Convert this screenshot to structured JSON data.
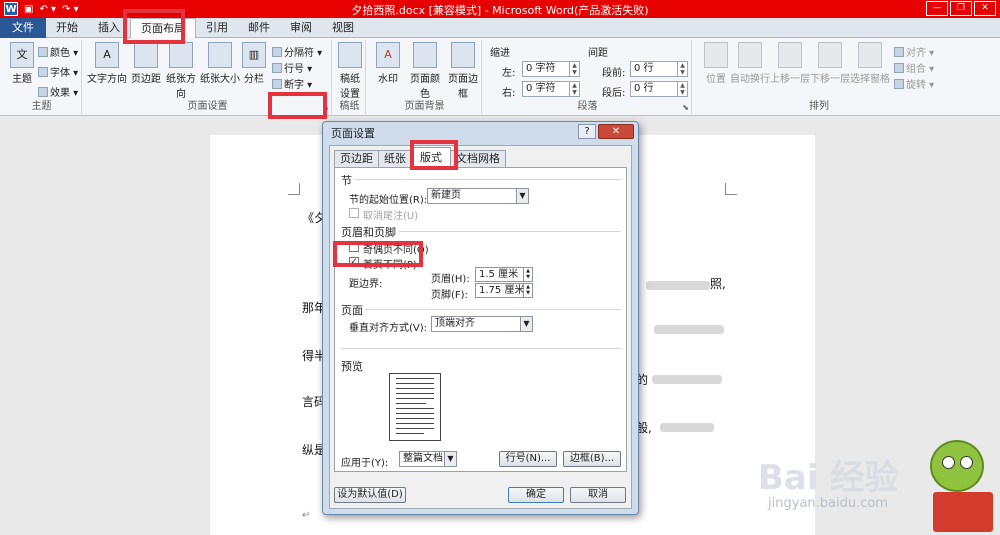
{
  "window": {
    "title": "夕拾西照.docx [兼容模式] - Microsoft Word(产品激活失败)",
    "app_icon": "W",
    "undo_icon": "undo-icon",
    "redo_icon": "redo-icon",
    "minimize": "—",
    "restore": "❐",
    "close": "✕"
  },
  "tabs": [
    "文件",
    "开始",
    "插入",
    "页面布局",
    "引用",
    "邮件",
    "审阅",
    "视图"
  ],
  "ribbon": {
    "theme": {
      "label": "主题",
      "btn": "主题",
      "colors": "颜色 ▾",
      "fonts": "字体 ▾",
      "effects": "效果 ▾"
    },
    "page_setup": {
      "label": "页面设置",
      "text_direction": "文字方向",
      "margins": "页边距",
      "orientation": "纸张方向",
      "size": "纸张大小",
      "columns": "分栏",
      "breaks": "分隔符 ▾",
      "line_numbers": "行号 ▾",
      "hyphenation": "断字 ▾"
    },
    "draft": {
      "label": "稿纸",
      "btn_line1": "稿纸",
      "btn_line2": "设置"
    },
    "page_bg": {
      "label": "页面背景",
      "watermark": "水印",
      "page_color": "页面颜色",
      "page_border": "页面边框"
    },
    "paragraph": {
      "label": "段落",
      "indent": "缩进",
      "spacing": "间距",
      "left": "左:",
      "right": "右:",
      "before": "段前:",
      "after": "段后:",
      "left_val": "0 字符",
      "right_val": "0 字符",
      "before_val": "0 行",
      "after_val": "0 行"
    },
    "arrange": {
      "label": "排列",
      "position": "位置",
      "wrap": "自动换行",
      "forward": "上移一层",
      "backward": "下移一层",
      "pane": "选择窗格",
      "align": "对齐 ▾",
      "group": "组合 ▾",
      "rotate": "旋转 ▾"
    }
  },
  "document": {
    "line1": "《夕",
    "line2": "那年",
    "line3": "得半",
    "line4": "言码",
    "line5": "纵是",
    "frag1": "照,",
    "frag2": "的",
    "frag3": "般,"
  },
  "dialog": {
    "title": "页面设置",
    "help": "?",
    "close": "✕",
    "tabs": [
      "页边距",
      "纸张",
      "版式",
      "文档网格"
    ],
    "section": {
      "heading": "节",
      "start_label": "节的起始位置(R):",
      "start_value": "新建页",
      "suppress_endnotes": "取消尾注(U)"
    },
    "header_footer": {
      "heading": "页眉和页脚",
      "odd_even": "奇偶页不同(O)",
      "first_page": "首页不同(P)",
      "first_page_checked": true,
      "from_edge": "距边界:",
      "header_label": "页眉(H):",
      "header_value": "1.5 厘米",
      "footer_label": "页脚(F):",
      "footer_value": "1.75 厘米"
    },
    "page": {
      "heading": "页面",
      "valign_label": "垂直对齐方式(V):",
      "valign_value": "顶端对齐"
    },
    "preview": {
      "heading": "预览"
    },
    "apply_label": "应用于(Y):",
    "apply_value": "整篇文档",
    "line_numbers_btn": "行号(N)...",
    "borders_btn": "边框(B)...",
    "default_btn": "设为默认值(D)",
    "ok_btn": "确定",
    "cancel_btn": "取消"
  },
  "watermark": {
    "brand": "Bai 经验",
    "url": "jingyan.baidu.com"
  },
  "colors": {
    "titlebar": "#e60000",
    "highlight": "#e3333f",
    "file_tab": "#2b5797"
  }
}
